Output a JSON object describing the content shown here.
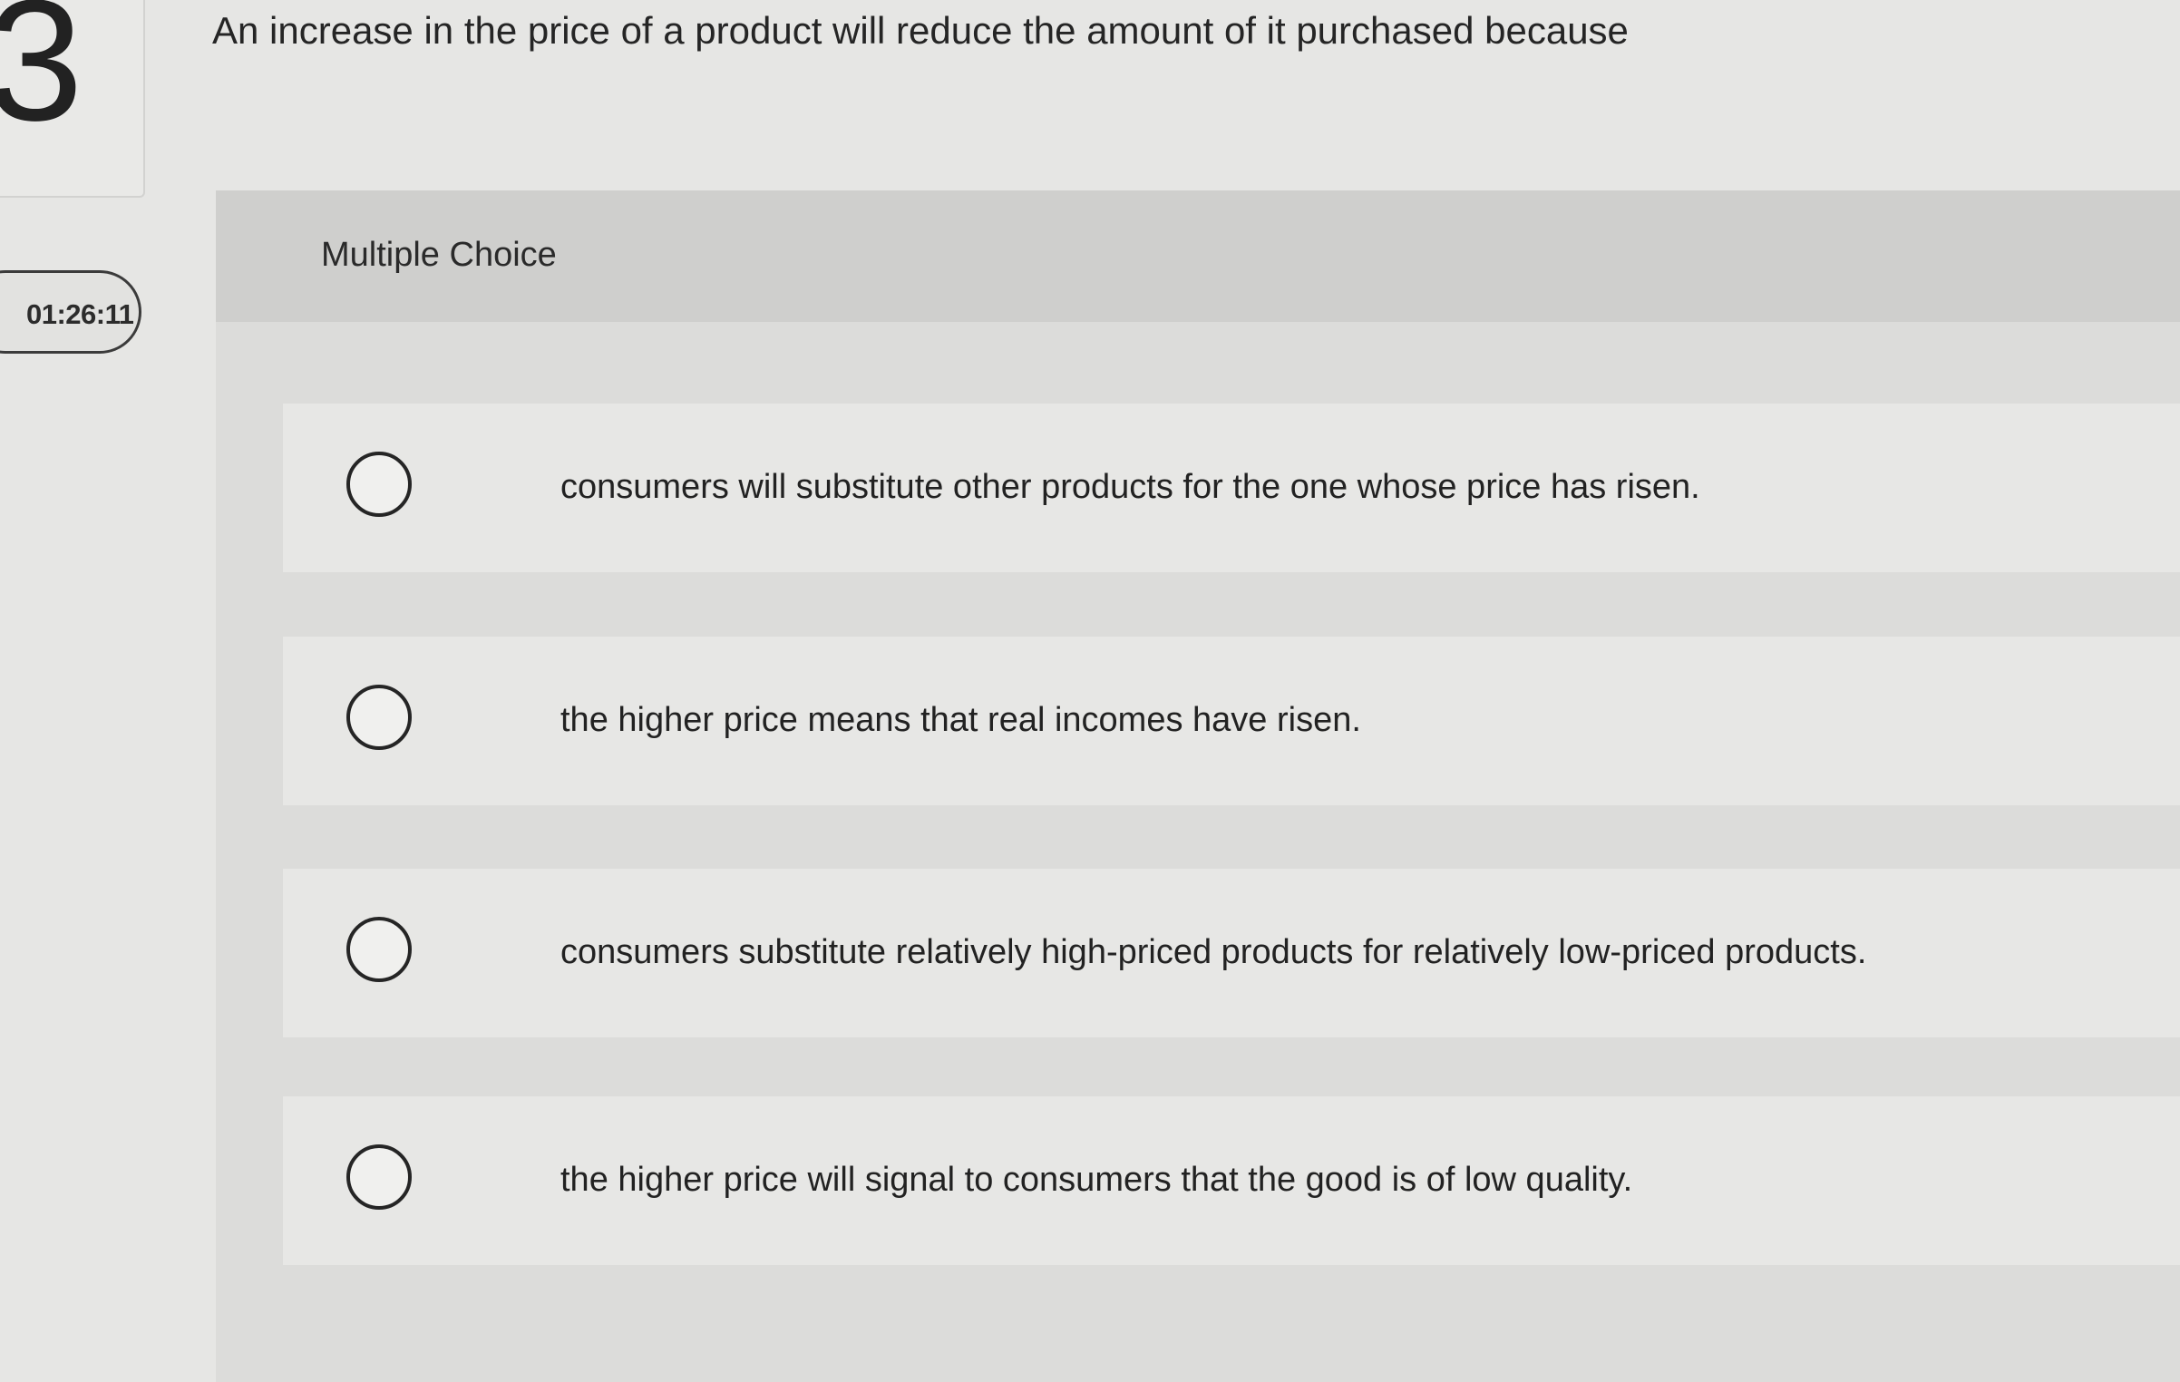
{
  "question": {
    "number": "3",
    "text": "An increase in the price of a product will reduce the amount of it purchased because"
  },
  "timer": {
    "value": "01:26:11"
  },
  "panel": {
    "label": "Multiple Choice"
  },
  "options": [
    {
      "label": "consumers will substitute other products for the one whose price has risen.",
      "selected": false
    },
    {
      "label": "the higher price means that real incomes have risen.",
      "selected": false
    },
    {
      "label": "consumers substitute relatively high-priced products for relatively low-priced products.",
      "selected": false
    },
    {
      "label": "the higher price will signal to consumers that the good is of low quality.",
      "selected": false
    }
  ],
  "colors": {
    "page_background": "#e6e6e4",
    "panel_background": "#dcdcda",
    "option_background": "#e7e7e5",
    "text": "#1f1f1f"
  }
}
